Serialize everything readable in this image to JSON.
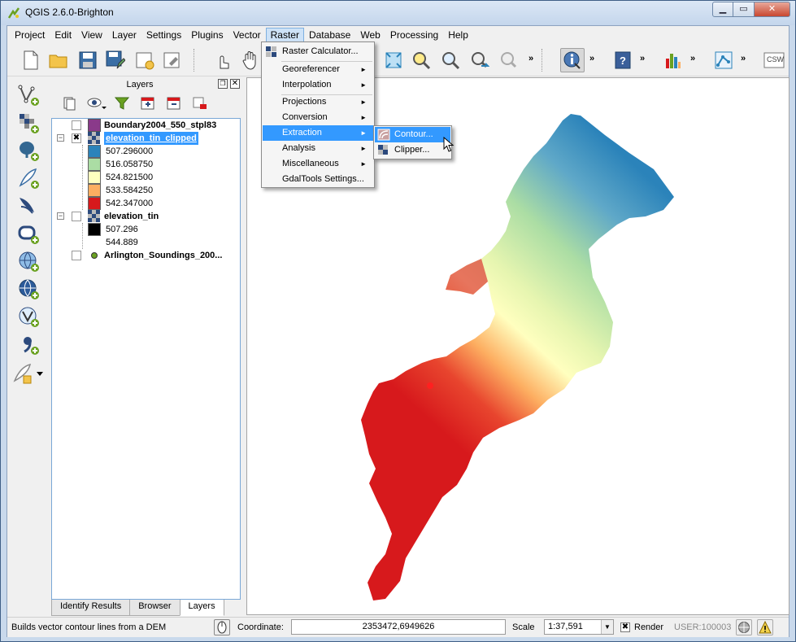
{
  "window": {
    "title": "QGIS 2.6.0-Brighton",
    "min": "▁",
    "max": "▭",
    "close": "✕"
  },
  "menubar": [
    "Project",
    "Edit",
    "View",
    "Layer",
    "Settings",
    "Plugins",
    "Vector",
    "Raster",
    "Database",
    "Web",
    "Processing",
    "Help"
  ],
  "toolbar": {
    "more": "»",
    "csw": "CSW"
  },
  "layers_panel": {
    "title": "Layers",
    "layers": [
      {
        "name": "Boundary2004_550_stpl83",
        "checked": ""
      },
      {
        "name": "elevation_tin_clipped",
        "checked": "✖",
        "expanded": "−",
        "legend": [
          {
            "value": "507.296000",
            "color": "#2b83ba"
          },
          {
            "value": "516.058750",
            "color": "#abdda4"
          },
          {
            "value": "524.821500",
            "color": "#ffffbf"
          },
          {
            "value": "533.584250",
            "color": "#fdae61"
          },
          {
            "value": "542.347000",
            "color": "#d7191c"
          }
        ]
      },
      {
        "name": "elevation_tin",
        "checked": "",
        "expanded": "−",
        "legend": [
          {
            "value": "507.296",
            "color": "#000000"
          },
          {
            "value": "544.889",
            "color": "#ffffff"
          }
        ]
      },
      {
        "name": "Arlington_Soundings_200...",
        "checked": ""
      }
    ],
    "tabs": [
      "Identify Results",
      "Browser",
      "Layers"
    ]
  },
  "raster_menu": {
    "items": [
      {
        "label": "Raster Calculator...",
        "submenu": false
      },
      {
        "label": "Georeferencer",
        "submenu": true
      },
      {
        "label": "Interpolation",
        "submenu": true
      },
      {
        "label": "Projections",
        "submenu": true
      },
      {
        "label": "Conversion",
        "submenu": true
      },
      {
        "label": "Extraction",
        "submenu": true
      },
      {
        "label": "Analysis",
        "submenu": true
      },
      {
        "label": "Miscellaneous",
        "submenu": true
      },
      {
        "label": "GdalTools Settings...",
        "submenu": false
      }
    ],
    "arrow": "►",
    "extraction_submenu": [
      "Contour...",
      "Clipper..."
    ]
  },
  "statusbar": {
    "message": "Builds vector contour lines from a DEM",
    "coordinate_label": "Coordinate:",
    "coordinate": "2353472,6949626",
    "scale_label": "Scale",
    "scale": "1:37,591",
    "render_label": "Render",
    "render_checked": "✖",
    "user": "USER:100003"
  },
  "colors": {
    "accent": "#3399ff",
    "low": "#2b83ba",
    "high": "#d7191c"
  }
}
